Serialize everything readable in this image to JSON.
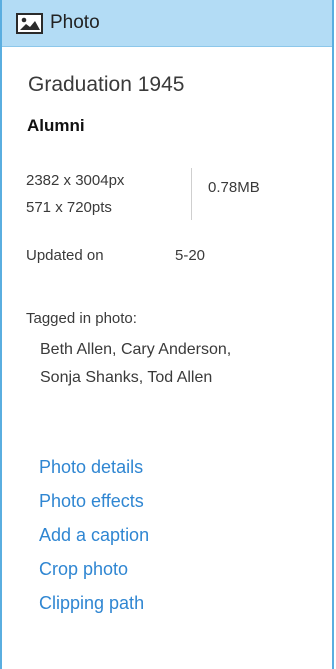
{
  "header": {
    "title": "Photo",
    "icon": "image-icon"
  },
  "photo": {
    "title": "Graduation 1945",
    "album": "Alumni",
    "pixel_dimensions": "2382 x 3004px",
    "point_dimensions": "571 x 720pts",
    "file_size": "0.78MB",
    "updated_label": "Updated on",
    "updated_value": "5-20",
    "tagged_label": "Tagged in photo:",
    "tagged_names_line1": "Beth Allen, Cary Anderson,",
    "tagged_names_line2": "Sonja Shanks, Tod Allen"
  },
  "links": [
    {
      "label": "Photo details"
    },
    {
      "label": "Photo effects"
    },
    {
      "label": "Add a caption"
    },
    {
      "label": "Crop photo"
    },
    {
      "label": "Clipping path"
    }
  ],
  "colors": {
    "header_bg": "#b3dcf5",
    "border": "#5aaee0",
    "link": "#2f86d2",
    "text": "#3a3a3a"
  }
}
